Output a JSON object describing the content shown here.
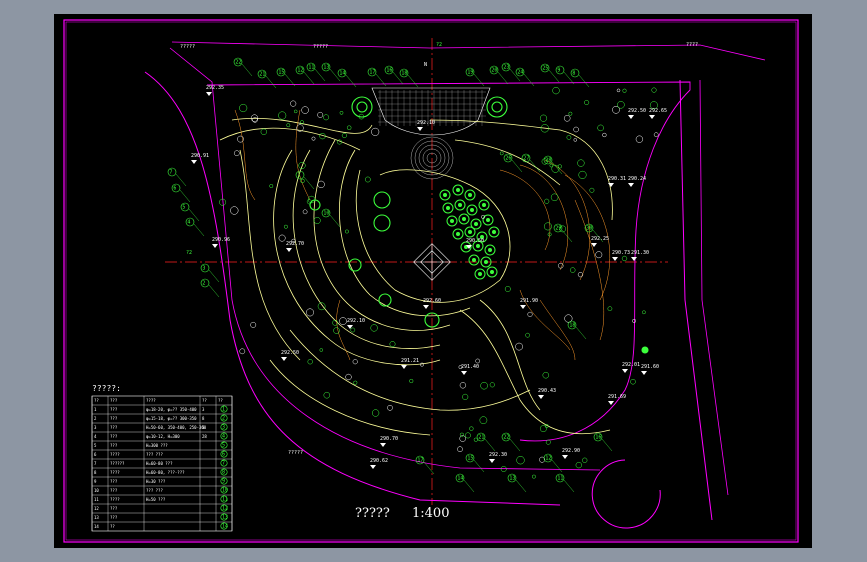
{
  "drawing": {
    "title": "?????",
    "scale": "1:400",
    "legend_title": "?????:",
    "north_label": "N",
    "axis_labels": [
      "?2",
      "?2"
    ],
    "colors": {
      "background": "#000000",
      "frame": "#ff00ff",
      "path": "#ffff9a",
      "plant": "#3cff3c",
      "axis": "#ff2020",
      "leader": "#ff9a2a",
      "paving": "#ffffff"
    }
  },
  "elevations": [
    "292.35",
    "292.50",
    "292.65",
    "290.91",
    "290.31",
    "290.24",
    "290.96",
    "290.73",
    "291.30",
    "292.70",
    "292.10",
    "292.10",
    "292.50",
    "292.60",
    "291.21",
    "291.90",
    "291.40",
    "290.70",
    "290.62",
    "291.69",
    "291.60",
    "290.43",
    "290.50",
    "292.25",
    "292.30",
    "292.90",
    "292.01"
  ],
  "plant_tags": [
    "22",
    "21",
    "15",
    "12",
    "11",
    "13",
    "14",
    "17",
    "16",
    "18",
    "19",
    "20",
    "23",
    "24",
    "25",
    "9",
    "8",
    "7",
    "6",
    "5",
    "4",
    "3",
    "2",
    "1",
    "10",
    "26",
    "27",
    "28",
    "29",
    "30"
  ],
  "legend": {
    "columns": [
      "??",
      "???",
      "????",
      "??",
      "??"
    ],
    "rows": [
      {
        "no": "1",
        "name": "???",
        "spec": "φ=18-20, φ=?? 350-400",
        "qty": "3",
        "sym": "1"
      },
      {
        "no": "2",
        "name": "???",
        "spec": "φ=15-18, φ=?? 300-350",
        "qty": "8",
        "sym": "2"
      },
      {
        "no": "3",
        "name": "???",
        "spec": "H=50-60, 350-400, 250-300",
        "qty": "5",
        "sym": "3"
      },
      {
        "no": "4",
        "name": "???",
        "spec": "φ=10-12, H=300",
        "qty": "28",
        "sym": "4"
      },
      {
        "no": "5",
        "name": "???",
        "spec": "H=300 ???",
        "qty": "",
        "sym": "5"
      },
      {
        "no": "6",
        "name": "????",
        "spec": "??? ???",
        "qty": "",
        "sym": "6"
      },
      {
        "no": "7",
        "name": "??????",
        "spec": "H=60-80 ???",
        "qty": "",
        "sym": "7"
      },
      {
        "no": "8",
        "name": "????",
        "spec": "H=60-80, ???-???",
        "qty": "",
        "sym": "8"
      },
      {
        "no": "9",
        "name": "???",
        "spec": "H=30 ???",
        "qty": "",
        "sym": "9"
      },
      {
        "no": "10",
        "name": "???",
        "spec": "??? ???",
        "qty": "",
        "sym": "10"
      },
      {
        "no": "11",
        "name": "????",
        "spec": "H=50 ???",
        "qty": "",
        "sym": "11"
      },
      {
        "no": "12",
        "name": "???",
        "spec": "",
        "qty": "",
        "sym": "12"
      },
      {
        "no": "13",
        "name": "???",
        "spec": "",
        "qty": "",
        "sym": "13"
      },
      {
        "no": "14",
        "name": "??",
        "spec": "",
        "qty": "",
        "sym": "14"
      }
    ]
  },
  "callouts": [
    "?????",
    "?????",
    "????",
    "?????"
  ]
}
